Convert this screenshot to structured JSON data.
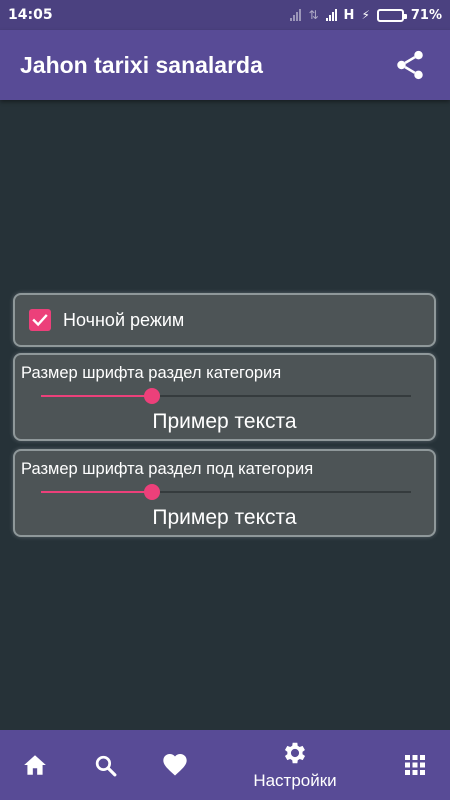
{
  "status_bar": {
    "time": "14:05",
    "network_type": "H",
    "battery_percent": "71%",
    "battery_level": 0.71,
    "battery_color": "#35c23a"
  },
  "app_bar": {
    "title": "Jahon tarixi sanalarda",
    "background": "#584b96",
    "share_icon": "share-icon"
  },
  "settings": {
    "night_mode": {
      "label": "Ночной режим",
      "checked": true
    },
    "category_font": {
      "label": "Размер шрифта раздел категория",
      "sample": "Пример текста",
      "slider_fraction": 0.3
    },
    "subcategory_font": {
      "label": "Размер шрифта раздел под категория",
      "sample": "Пример текста",
      "slider_fraction": 0.3
    },
    "accent_color": "#ec407a"
  },
  "bottom_nav": {
    "items": [
      {
        "icon": "home-icon"
      },
      {
        "icon": "search-icon"
      },
      {
        "icon": "heart-icon"
      },
      {
        "icon": "gear-icon",
        "label": "Настройки",
        "active": true
      },
      {
        "icon": "grid-icon"
      }
    ]
  }
}
